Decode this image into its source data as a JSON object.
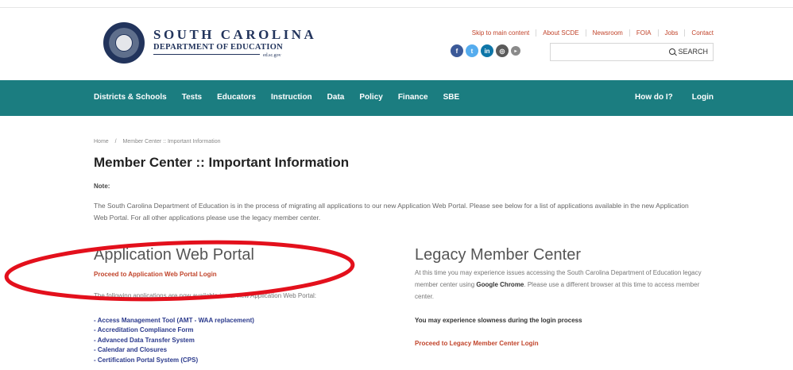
{
  "header": {
    "brand_line1": "SOUTH CAROLINA",
    "brand_line2": "DEPARTMENT OF EDUCATION",
    "brand_line3": "ed.sc.gov",
    "utility_links": [
      "Skip to main content",
      "About SCDE",
      "Newsroom",
      "FOIA",
      "Jobs",
      "Contact"
    ],
    "social": [
      {
        "icon": "facebook-icon",
        "glyph": "f",
        "color": "#3b5998"
      },
      {
        "icon": "twitter-icon",
        "glyph": "t",
        "color": "#55acee"
      },
      {
        "icon": "linkedin-icon",
        "glyph": "in",
        "color": "#0e76a8"
      },
      {
        "icon": "instagram-icon",
        "glyph": "◎",
        "color": "#5a5a5a"
      },
      {
        "icon": "youtube-icon",
        "glyph": "▸",
        "color": "#8a8a8a"
      }
    ],
    "search": {
      "placeholder": "",
      "button_label": "SEARCH"
    }
  },
  "nav": {
    "items": [
      "Districts & Schools",
      "Tests",
      "Educators",
      "Instruction",
      "Data",
      "Policy",
      "Finance",
      "SBE"
    ],
    "right_items": [
      "How do I?",
      "Login"
    ]
  },
  "breadcrumb": [
    "Home",
    "/",
    "Member Center :: Important Information"
  ],
  "page": {
    "title": "Member Center :: Important Information",
    "note_label": "Note:",
    "intro": "The South Carolina Department of Education is in the process of migrating all applications to our new Application Web Portal. Please see below for a list of applications available in the new Application Web Portal. For all other applications please use the legacy member center."
  },
  "portal": {
    "title": "Application Web Portal",
    "login_link": "Proceed to Application Web Portal Login",
    "intro": "The following applications are now available in our new Application Web Portal:",
    "apps": [
      "- Access Management Tool (AMT - WAA replacement)",
      "- Accreditation Compliance Form",
      "- Advanced Data Transfer System",
      "- Calendar and Closures",
      "- Certification Portal System (CPS)"
    ]
  },
  "legacy": {
    "title": "Legacy Member Center",
    "text_before": "At this time you may experience issues accessing the South Carolina Department of Education legacy member center using ",
    "text_bold": "Google Chrome",
    "text_after": ". Please use a different browser at this time to access member center.",
    "slowness": "You may experience slowness during the login process",
    "login_link": "Proceed to Legacy Member Center Login"
  },
  "colors": {
    "nav_bg": "#1b7d80",
    "accent": "#c1442b",
    "link_blue": "#2b3a8c",
    "oval": "#e3101c"
  }
}
